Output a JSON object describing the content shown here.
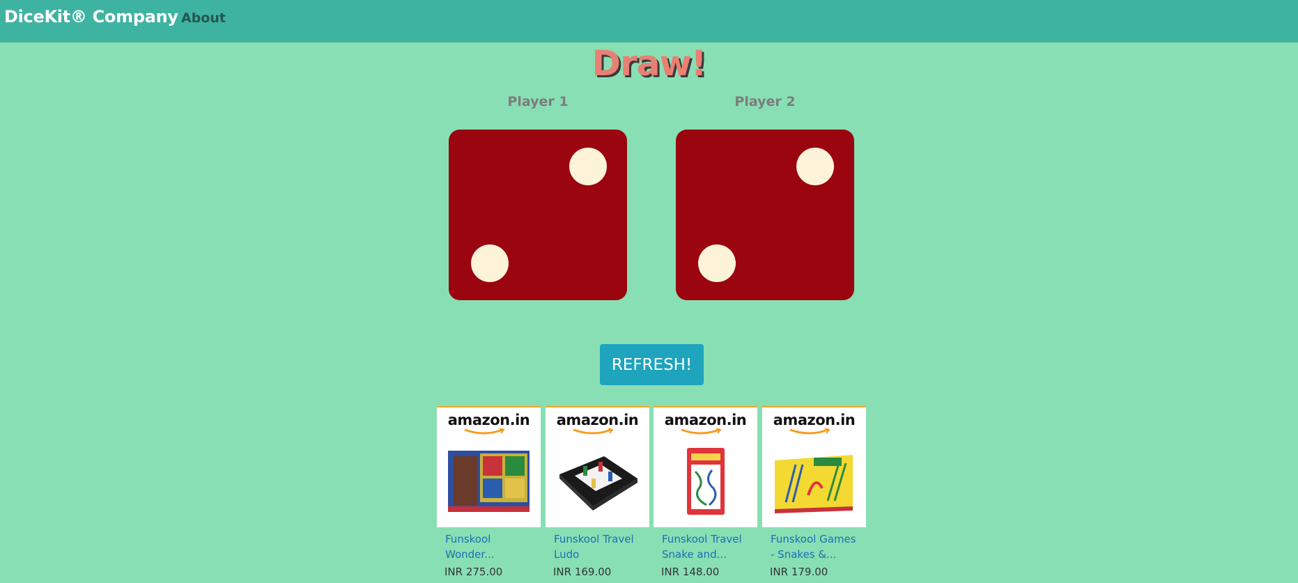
{
  "navbar": {
    "brand": "DiceKit® Company",
    "about_label": "About"
  },
  "game": {
    "result": "Draw!",
    "players": [
      {
        "label": "Player 1",
        "die_value": 2
      },
      {
        "label": "Player 2",
        "die_value": 2
      }
    ],
    "refresh_label": "REFRESH!"
  },
  "ads": [
    {
      "store": "amazon.in",
      "name_line1": "Funskool",
      "name_line2": "Wonder...",
      "price": "INR 275.00"
    },
    {
      "store": "amazon.in",
      "name_line1": "Funskool Travel",
      "name_line2": "Ludo",
      "price": "INR 169.00"
    },
    {
      "store": "amazon.in",
      "name_line1": "Funskool Travel",
      "name_line2": "Snake and...",
      "price": "INR 148.00"
    },
    {
      "store": "amazon.in",
      "name_line1": "Funskool Games",
      "name_line2": "- Snakes &...",
      "price": "INR 179.00"
    }
  ],
  "colors": {
    "background": "#88dfb3",
    "navbar": "#3fb3a2",
    "die": "#9a050f",
    "pip": "#fdf3d9",
    "refresh_button": "#1ea4bd",
    "title": "#e98074"
  }
}
